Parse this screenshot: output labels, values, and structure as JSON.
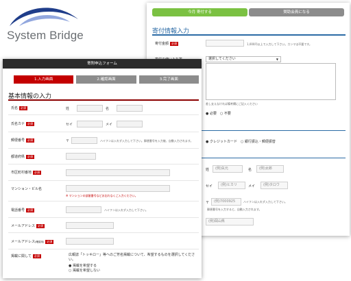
{
  "brand": {
    "name": "System Bridge",
    "swoosh_color": "#1f3d8a"
  },
  "back_form": {
    "tabs": [
      "今月 寄付する",
      "賛助会員になる"
    ],
    "section_title": "寄付情報入力",
    "amount": {
      "label": "寄付金額",
      "req": "必須",
      "note": "1,000円以上で入力して下さい。カンマは不要です。"
    },
    "purpose": {
      "label": "寄付の使いみち等",
      "select_value": "選択してください",
      "note": "差し支えなければ備考欄にご記入ください"
    },
    "receipt": {
      "options": [
        "必要",
        "不要"
      ]
    },
    "payment": {
      "options": [
        "クレジットカード",
        "銀行振込・郵便振替"
      ]
    },
    "name": {
      "sei_label": "姓",
      "mei_label": "名",
      "sei_placeholder": "(例)矢元",
      "mei_placeholder": "(例)太郎"
    },
    "kana": {
      "sei_label": "セイ",
      "mei_label": "メイ",
      "sei_placeholder": "(例)ヒカリ",
      "mei_placeholder": "(例)タロウ"
    },
    "zip": {
      "prefix": "〒",
      "placeholder": "(例)7000925",
      "note1": "ハイフンは入れず入力して下さい。",
      "note2": "郵便番号を入力すると、自動入力されます。"
    },
    "pref": {
      "placeholder": "(例)岡山県"
    }
  },
  "front_form": {
    "header": "寄附申込フォーム",
    "steps": [
      "1.入力画面",
      "2.確認画面",
      "3.完了画面"
    ],
    "section_title": "基本情報の入力",
    "req": "必須",
    "rows": {
      "name": {
        "label": "氏名",
        "sei": "姓",
        "mei": "名"
      },
      "kana": {
        "label": "氏名カナ",
        "sei": "セイ",
        "mei": "メイ"
      },
      "zip": {
        "label": "郵便番号",
        "prefix": "〒",
        "note": "ハイフンは入れず入力して下さい。郵便番号を入力後、自動入力されます。"
      },
      "pref": {
        "label": "都道府県"
      },
      "city": {
        "label": "市区町村番地"
      },
      "building": {
        "label": "マンション・ビル名",
        "note": "※ マンションの部屋番号などお忘れなくご入力ください。"
      },
      "phone": {
        "label": "電話番号",
        "note": "ハイフンは入れず入力して下さい。"
      },
      "email": {
        "label": "メールアドレス"
      },
      "email_confirm": {
        "label": "メールアドレス",
        "sub": "(確認用)"
      },
      "media": {
        "label": "掲載に関して",
        "text": "広報誌「トッキロー」等へのご芳名掲載について、希望するものを選択してください。",
        "opt1": "● 掲載を希望する",
        "opt2": "○ 掲載を希望しない"
      }
    }
  }
}
